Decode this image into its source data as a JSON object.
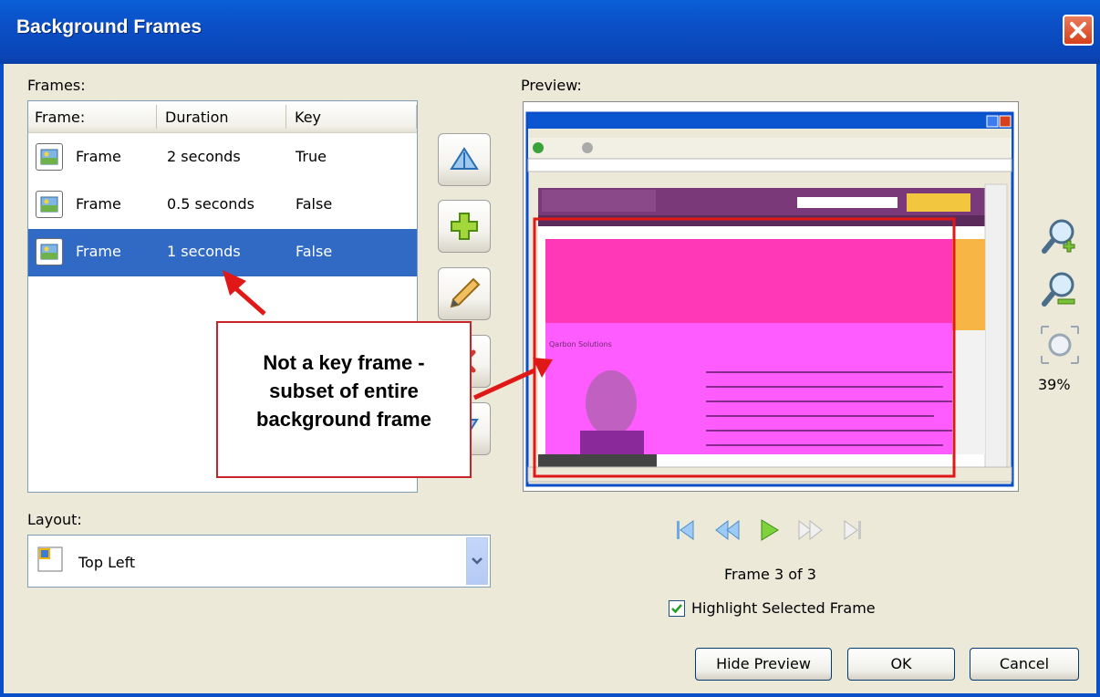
{
  "window": {
    "title": "Background Frames"
  },
  "frames_label": "Frames:",
  "frames_table": {
    "columns": [
      "Frame:",
      "Duration",
      "Key"
    ],
    "rows": [
      {
        "name": "Frame",
        "duration": "2 seconds",
        "key": "True",
        "selected": false
      },
      {
        "name": "Frame",
        "duration": "0.5 seconds",
        "key": "False",
        "selected": false
      },
      {
        "name": "Frame",
        "duration": "1 seconds",
        "key": "False",
        "selected": true
      }
    ]
  },
  "side_buttons": [
    "move-up-icon",
    "add-icon",
    "edit-icon",
    "delete-icon",
    "move-down-icon"
  ],
  "callout": {
    "lines": [
      "Not a key frame -",
      "subset of entire",
      "background frame"
    ]
  },
  "preview": {
    "label": "Preview:",
    "zoom": "39%"
  },
  "layout": {
    "label": "Layout:",
    "value": "Top Left"
  },
  "playback": {
    "frame_status": "Frame 3 of 3",
    "highlight_label": "Highlight Selected Frame",
    "highlight_checked": true
  },
  "buttons": {
    "hide_preview": "Hide Preview",
    "ok": "OK",
    "cancel": "Cancel"
  },
  "colors": {
    "titlebar": "#0a4fc7",
    "selection": "#316ac5",
    "callout_border": "#c8242a",
    "highlight": "#ff40ff"
  }
}
